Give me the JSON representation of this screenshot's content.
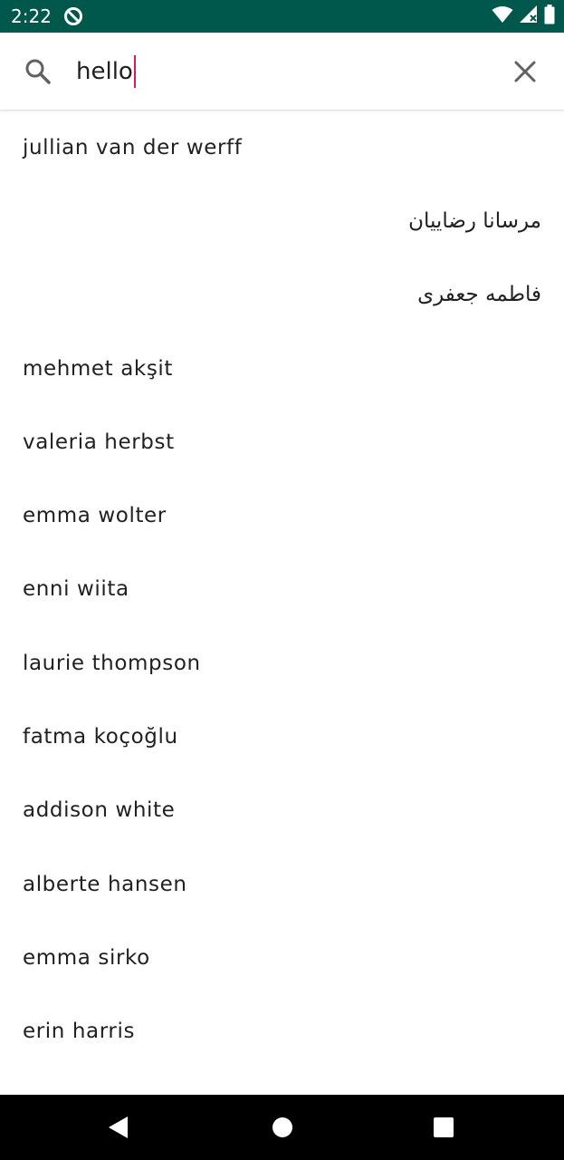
{
  "status_bar": {
    "time": "2:22",
    "app_icon": "do-not-disturb-icon",
    "icons": [
      "wifi-icon",
      "signal-icon",
      "battery-icon"
    ],
    "background_color": "#00574b"
  },
  "search": {
    "icon": "search-icon",
    "query": "hello",
    "clear_icon": "close-icon",
    "cursor_color": "#d81b60"
  },
  "results": [
    {
      "name": "jullian van der werff",
      "dir": "ltr"
    },
    {
      "name": "مرسانا رضاییان",
      "dir": "rtl"
    },
    {
      "name": "فاطمه جعفری",
      "dir": "rtl"
    },
    {
      "name": "mehmet akşit",
      "dir": "ltr"
    },
    {
      "name": "valeria herbst",
      "dir": "ltr"
    },
    {
      "name": "emma wolter",
      "dir": "ltr"
    },
    {
      "name": "enni wiita",
      "dir": "ltr"
    },
    {
      "name": "laurie thompson",
      "dir": "ltr"
    },
    {
      "name": "fatma koçoğlu",
      "dir": "ltr"
    },
    {
      "name": "addison white",
      "dir": "ltr"
    },
    {
      "name": "alberte hansen",
      "dir": "ltr"
    },
    {
      "name": "emma sirko",
      "dir": "ltr"
    },
    {
      "name": "erin harris",
      "dir": "ltr"
    }
  ],
  "nav_bar": {
    "buttons": [
      "back-icon",
      "home-icon",
      "recents-icon"
    ]
  }
}
